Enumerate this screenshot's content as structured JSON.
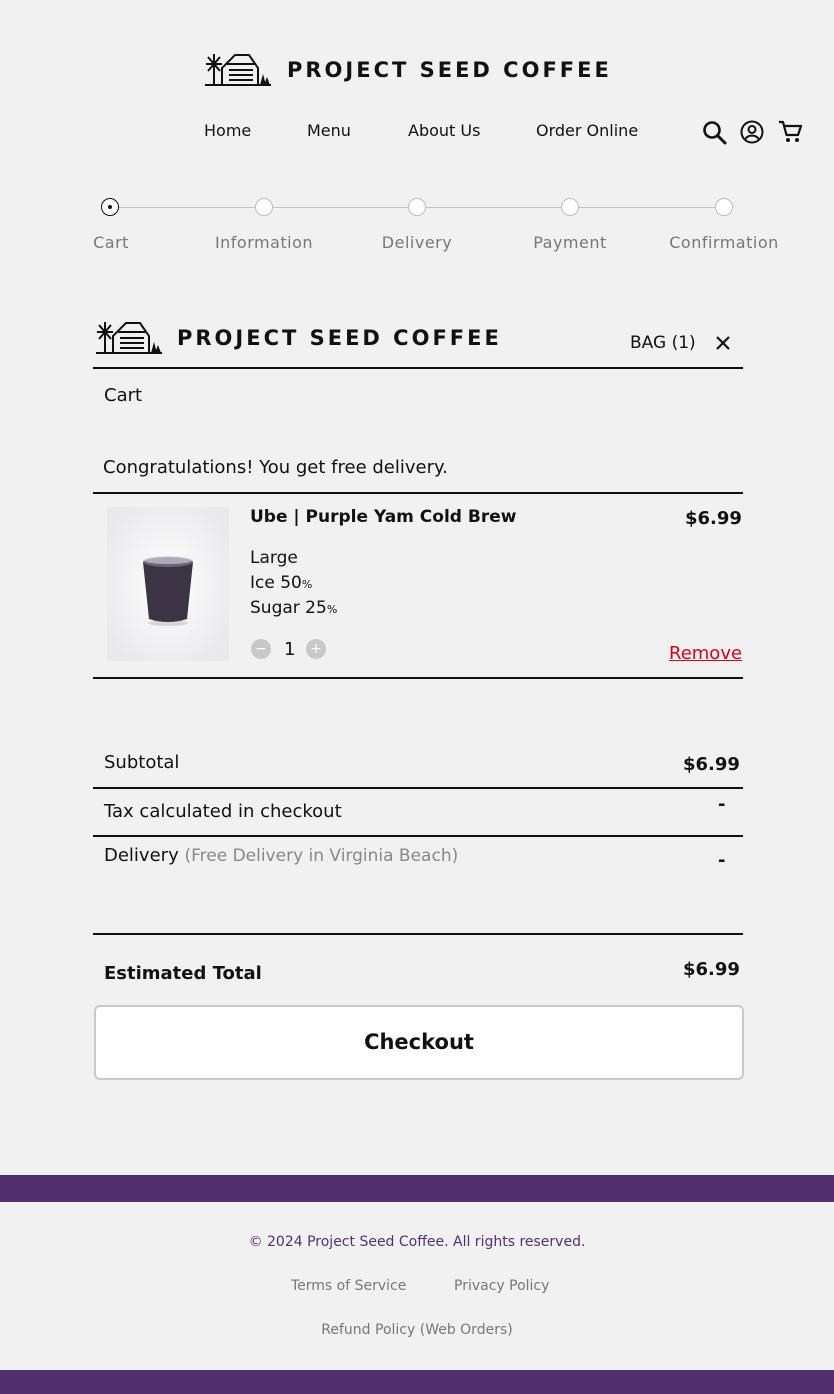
{
  "brand": {
    "name": "PROJECT SEED COFFEE"
  },
  "nav": {
    "items": [
      {
        "label": "Home"
      },
      {
        "label": "Menu"
      },
      {
        "label": "About Us"
      },
      {
        "label": "Order Online"
      }
    ]
  },
  "icons": {
    "search": "search-icon",
    "account": "user-circle-icon",
    "cart": "cart-icon",
    "close": "close-icon"
  },
  "steps": [
    {
      "label": "Cart",
      "active": true
    },
    {
      "label": "Information",
      "active": false
    },
    {
      "label": "Delivery",
      "active": false
    },
    {
      "label": "Payment",
      "active": false
    },
    {
      "label": "Confirmation",
      "active": false
    }
  ],
  "bag": {
    "label": "BAG (1)",
    "section_title": "Cart",
    "notice": "Congratulations! You get free delivery."
  },
  "item": {
    "name": "Ube | Purple Yam Cold Brew",
    "price": "$6.99",
    "size": "Large",
    "ice_label": "Ice",
    "ice_value": "50",
    "sugar_label": "Sugar",
    "sugar_value": "25",
    "percent": "%",
    "quantity": "1",
    "minus": "−",
    "plus": "+",
    "remove_label": "Remove"
  },
  "summary": {
    "subtotal_label": "Subtotal",
    "subtotal_value": "$6.99",
    "tax_label": "Tax calculated in checkout",
    "tax_value": "-",
    "delivery_label": "Delivery",
    "delivery_note": "(Free Delivery in Virginia Beach)",
    "delivery_value": "-",
    "total_label": "Estimated Total",
    "total_value": "$6.99"
  },
  "checkout": {
    "label": "Checkout"
  },
  "footer": {
    "copyright": "© 2024 Project Seed Coffee. All rights reserved.",
    "terms": "Terms of Service",
    "privacy": "Privacy Policy",
    "refund": "Refund Policy (Web Orders)"
  },
  "colors": {
    "accent": "#523070",
    "remove": "#d9001b",
    "background": "#f1f1f1"
  }
}
